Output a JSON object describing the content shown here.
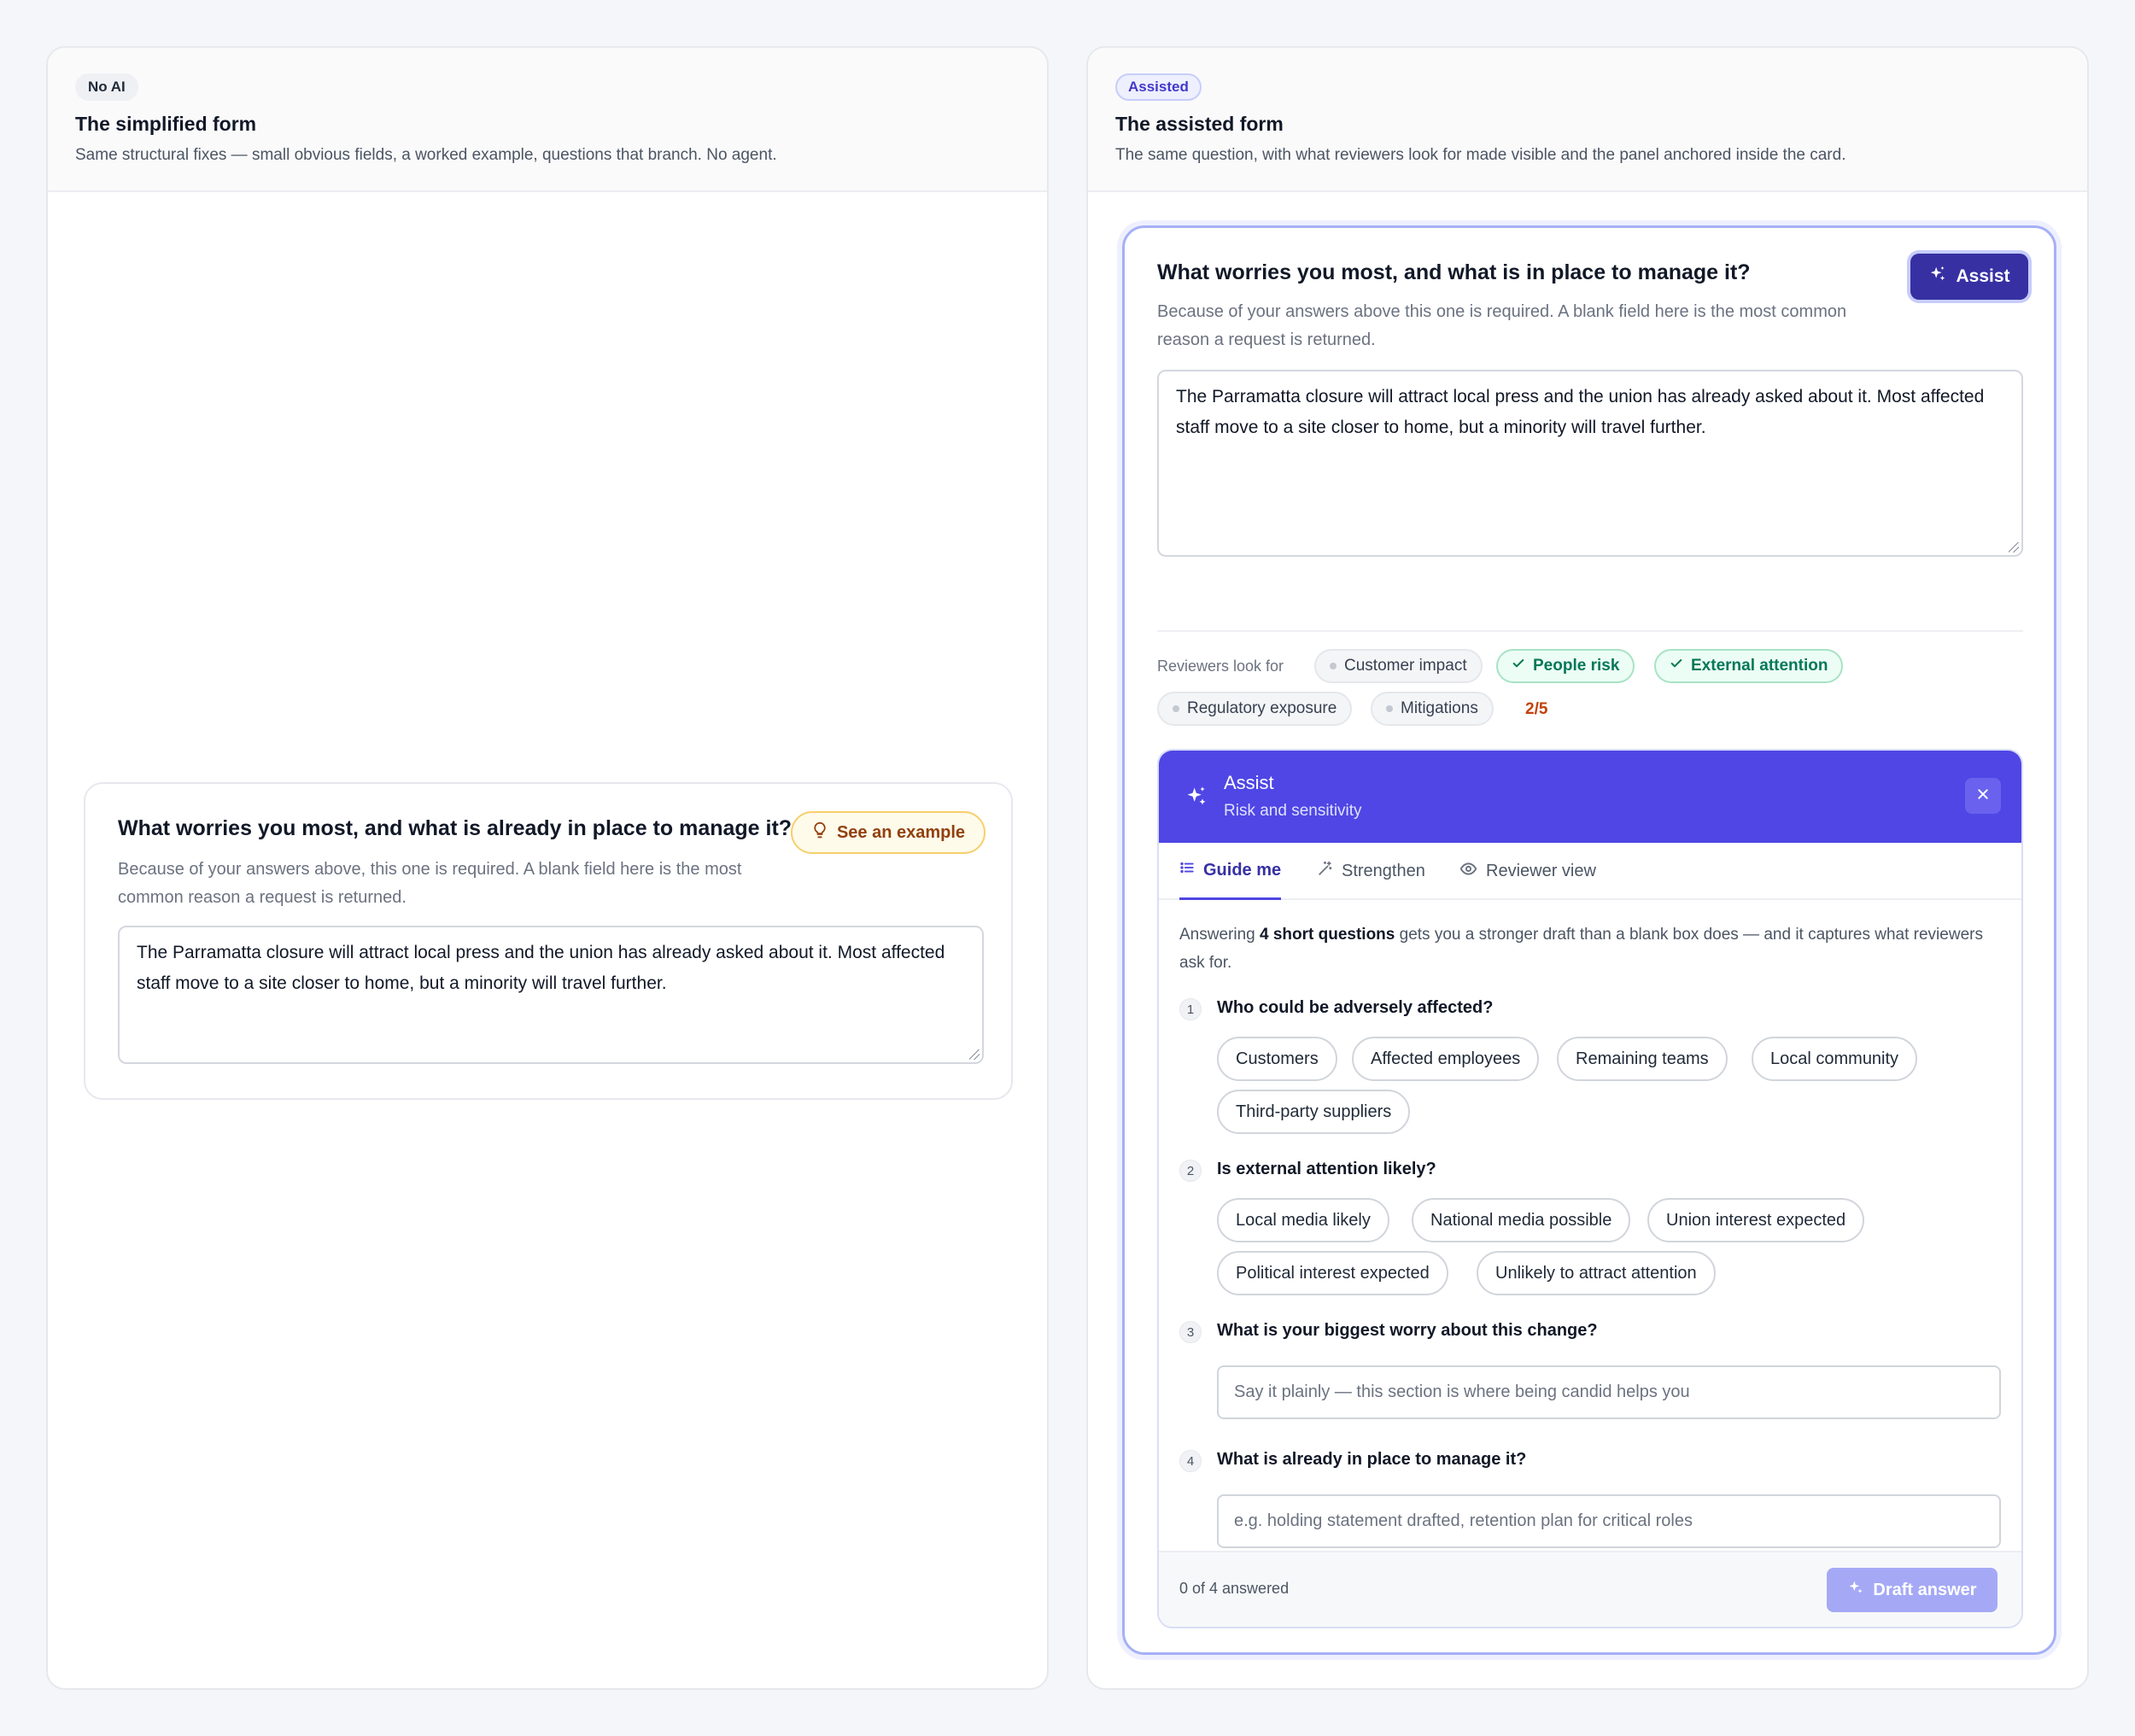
{
  "left": {
    "tag": "No AI",
    "title": "The simplified form",
    "subtitle": "Same structural fixes — small obvious fields, a worked example, questions that branch. No agent.",
    "question": {
      "title": "What worries you most, and what is already in place to manage it?",
      "help": "Because of your answers above, this one is required. A blank field here is the most common reason a request is returned.",
      "example_label": "See an example",
      "answer": "The Parramatta closure will attract local press and the union has already asked about it. Most affected staff move to a site closer to home, but a minority will travel further."
    }
  },
  "right": {
    "tag": "Assisted",
    "title": "The assisted form",
    "subtitle": "The same question, with what reviewers look for made visible and the panel anchored inside the card.",
    "question": {
      "title": "What worries you most, and what is in place to manage it?",
      "help": "Because of your answers above this one is required. A blank field here is the most common reason a request is returned.",
      "assist_label": "Assist",
      "answer": "The Parramatta closure will attract local press and the union has already asked about it. Most affected staff move to a site closer to home, but a minority will travel further."
    },
    "reviewers": {
      "label": "Reviewers look for",
      "chips": [
        {
          "label": "Customer impact",
          "met": false
        },
        {
          "label": "People risk",
          "met": true
        },
        {
          "label": "External attention",
          "met": true
        },
        {
          "label": "Regulatory exposure",
          "met": false
        },
        {
          "label": "Mitigations",
          "met": false
        }
      ],
      "score": "2/5"
    },
    "assist_panel": {
      "title": "Assist",
      "subtitle": "Risk and sensitivity",
      "tabs": [
        "Guide me",
        "Strengthen",
        "Reviewer view"
      ],
      "active_tab": "Guide me",
      "intro_prefix": "Answering ",
      "intro_bold": "4 short questions",
      "intro_suffix": " gets you a stronger draft than a blank box does — and it captures what reviewers ask for.",
      "questions": [
        {
          "num": "1",
          "text": "Who could be adversely affected?",
          "options": [
            "Customers",
            "Affected employees",
            "Remaining teams",
            "Local community",
            "Third-party suppliers"
          ]
        },
        {
          "num": "2",
          "text": "Is external attention likely?",
          "options": [
            "Local media likely",
            "National media possible",
            "Union interest expected",
            "Political interest expected",
            "Unlikely to attract attention"
          ]
        },
        {
          "num": "3",
          "text": "What is your biggest worry about this change?",
          "placeholder": "Say it plainly — this section is where being candid helps you"
        },
        {
          "num": "4",
          "text": "What is already in place to manage it?",
          "placeholder": "e.g. holding statement drafted, retention plan for critical roles"
        }
      ],
      "answered": "0 of 4 answered",
      "draft_label": "Draft answer"
    }
  }
}
